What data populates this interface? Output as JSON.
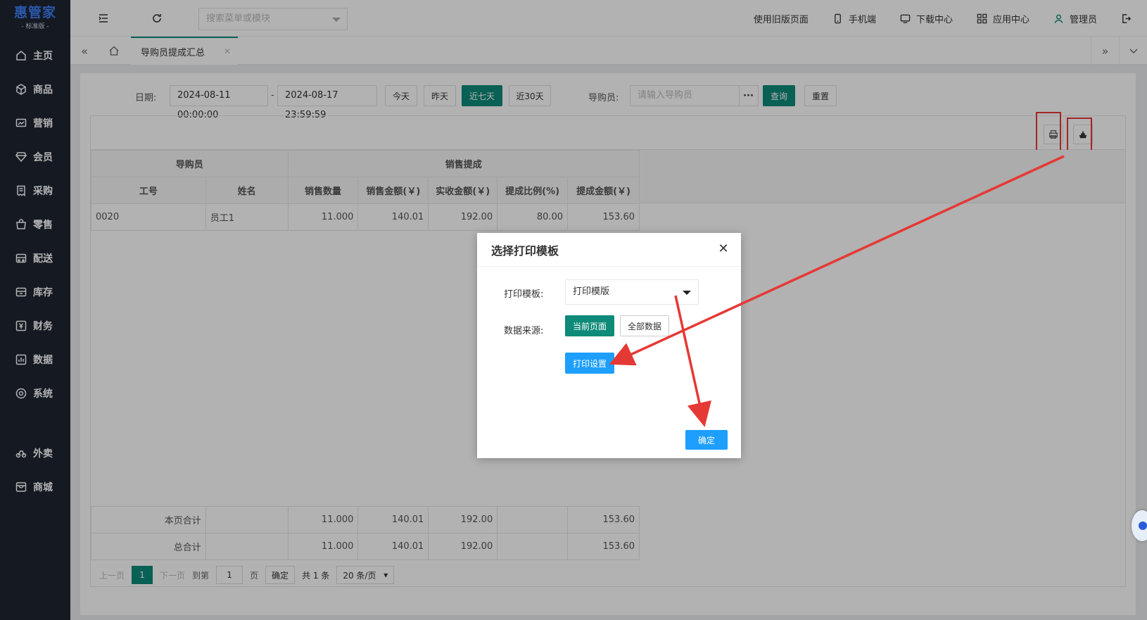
{
  "brand": {
    "name": "惠管家",
    "edition": "- 标准版 -"
  },
  "sidebar": {
    "items": [
      {
        "label": "主页",
        "icon": "home-icon"
      },
      {
        "label": "商品",
        "icon": "cube-icon"
      },
      {
        "label": "营销",
        "icon": "chart-icon"
      },
      {
        "label": "会员",
        "icon": "diamond-icon"
      },
      {
        "label": "采购",
        "icon": "receipt-icon"
      },
      {
        "label": "零售",
        "icon": "bag-icon"
      },
      {
        "label": "配送",
        "icon": "truck-icon"
      },
      {
        "label": "库存",
        "icon": "storage-icon"
      },
      {
        "label": "财务",
        "icon": "yuan-icon"
      },
      {
        "label": "数据",
        "icon": "bar-chart-icon"
      },
      {
        "label": "系统",
        "icon": "settings-icon"
      }
    ],
    "extra": [
      {
        "label": "外卖",
        "icon": "bike-icon"
      },
      {
        "label": "商城",
        "icon": "shop-icon"
      }
    ]
  },
  "header": {
    "search_placeholder": "搜索菜单或模块",
    "links": [
      "使用旧版页面",
      "手机端",
      "下载中心",
      "应用中心",
      "管理员"
    ]
  },
  "tabs": {
    "active": "导购员提成汇总"
  },
  "filter": {
    "date_label": "日期:",
    "date_start": "2024-08-11 00:00:00",
    "date_sep": "-",
    "date_end": "2024-08-17 23:59:59",
    "quick": [
      "今天",
      "昨天",
      "近七天",
      "近30天"
    ],
    "quick_active": "近七天",
    "guide_label": "导购员:",
    "guide_placeholder": "请输入导购员",
    "query": "查询",
    "reset": "重置"
  },
  "table": {
    "group_headers": [
      "导购员",
      "销售提成"
    ],
    "columns": [
      "工号",
      "姓名",
      "销售数量",
      "销售金额(￥)",
      "实收金额(￥)",
      "提成比例(%)",
      "提成金额(￥)"
    ],
    "rows": [
      [
        "0020",
        "员工1",
        "11.000",
        "140.01",
        "192.00",
        "80.00",
        "153.60"
      ]
    ],
    "page_total_label": "本页合计",
    "page_total": [
      "11.000",
      "140.01",
      "192.00",
      "",
      "153.60"
    ],
    "grand_total_label": "总合计",
    "grand_total": [
      "11.000",
      "140.01",
      "192.00",
      "",
      "153.60"
    ]
  },
  "pager": {
    "prev": "上一页",
    "current": "1",
    "next": "下一页",
    "goto": "到第",
    "goto_value": "1",
    "page_unit": "页",
    "confirm": "确定",
    "total": "共 1 条",
    "size": "20 条/页"
  },
  "modal": {
    "title": "选择打印模板",
    "template_label": "打印模板:",
    "template_value": "打印模版",
    "source_label": "数据来源:",
    "source_current": "当前页面",
    "source_all": "全部数据",
    "print_settings": "打印设置",
    "ok": "确定"
  },
  "colors": {
    "primary": "#0e8a79",
    "blue": "#1e9fff",
    "sidebar": "#1f2532",
    "annotation": "#e53935"
  }
}
